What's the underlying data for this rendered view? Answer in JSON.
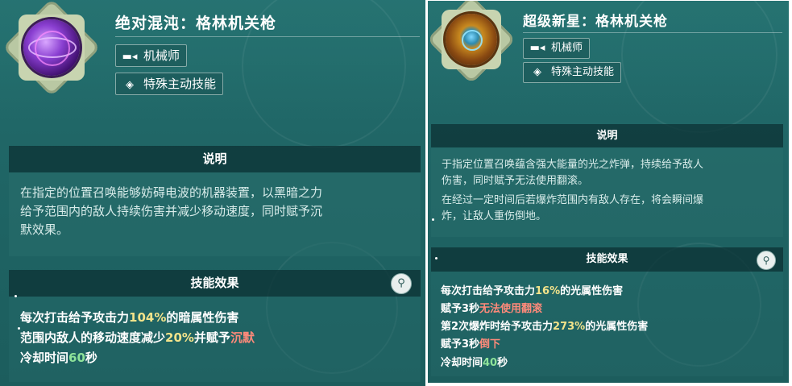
{
  "left": {
    "title": "绝对混沌：格林机关枪",
    "class_tag": "机械师",
    "type_tag": "特殊主动技能",
    "desc_header": "说明",
    "desc_line1": "在指定的位置召唤能够妨碍电波的机器装置，以黑暗之力",
    "desc_line2": "给予范围内的敌人持续伤害并减少移动速度，同时赋予沉",
    "desc_line3": "默效果。",
    "effect_header": "技能效果",
    "e1_a": "每次打击给予攻击力",
    "e1_v": "104%",
    "e1_b": "的暗属性伤害",
    "e2_a": "范围内敌人的移动速度减少",
    "e2_v": "20%",
    "e2_b": "并赋予",
    "e2_c": "沉默",
    "e3_a": "冷却时间",
    "e3_v": "60",
    "e3_b": "秒"
  },
  "right": {
    "title": "超级新星：格林机关枪",
    "class_tag": "机械师",
    "type_tag": "特殊主动技能",
    "desc_header": "说明",
    "desc_line1": "于指定位置召唤蕴含强大能量的光之炸弹，持续给予敌人",
    "desc_line2": "伤害，同时赋予无法使用翻滚。",
    "desc_line3": "在经过一定时间后若爆炸范围内有敌人存在，将会瞬间爆",
    "desc_line4": "炸，让敌人重伤倒地。",
    "effect_header": "技能效果",
    "e1_a": "每次打击给予攻击力",
    "e1_v": "16%",
    "e1_b": "的光属性伤害",
    "e2_a": "赋予3秒",
    "e2_c": "无法使用翻滚",
    "e3_a": "第2次爆炸时给予攻击力",
    "e3_v": "273%",
    "e3_b": "的光属性伤害",
    "e4_a": "赋予3秒",
    "e4_c": "倒下",
    "e5_a": "冷却时间",
    "e5_v": "40",
    "e5_b": "秒"
  },
  "icons": {
    "class_icon": "wrench-gun-icon",
    "type_icon": "target-diamond-icon",
    "search_icon": "magnifier-icon",
    "left_skill_icon": "purple-vortex-bottle-icon",
    "right_skill_icon": "golden-supernova-orb-icon"
  },
  "colors": {
    "panel_bg": "#1f6565",
    "header_dark": "#0c3234",
    "highlight_yellow": "#f3e38a",
    "highlight_green": "#8ee39a",
    "highlight_red": "#ff8a7a"
  }
}
